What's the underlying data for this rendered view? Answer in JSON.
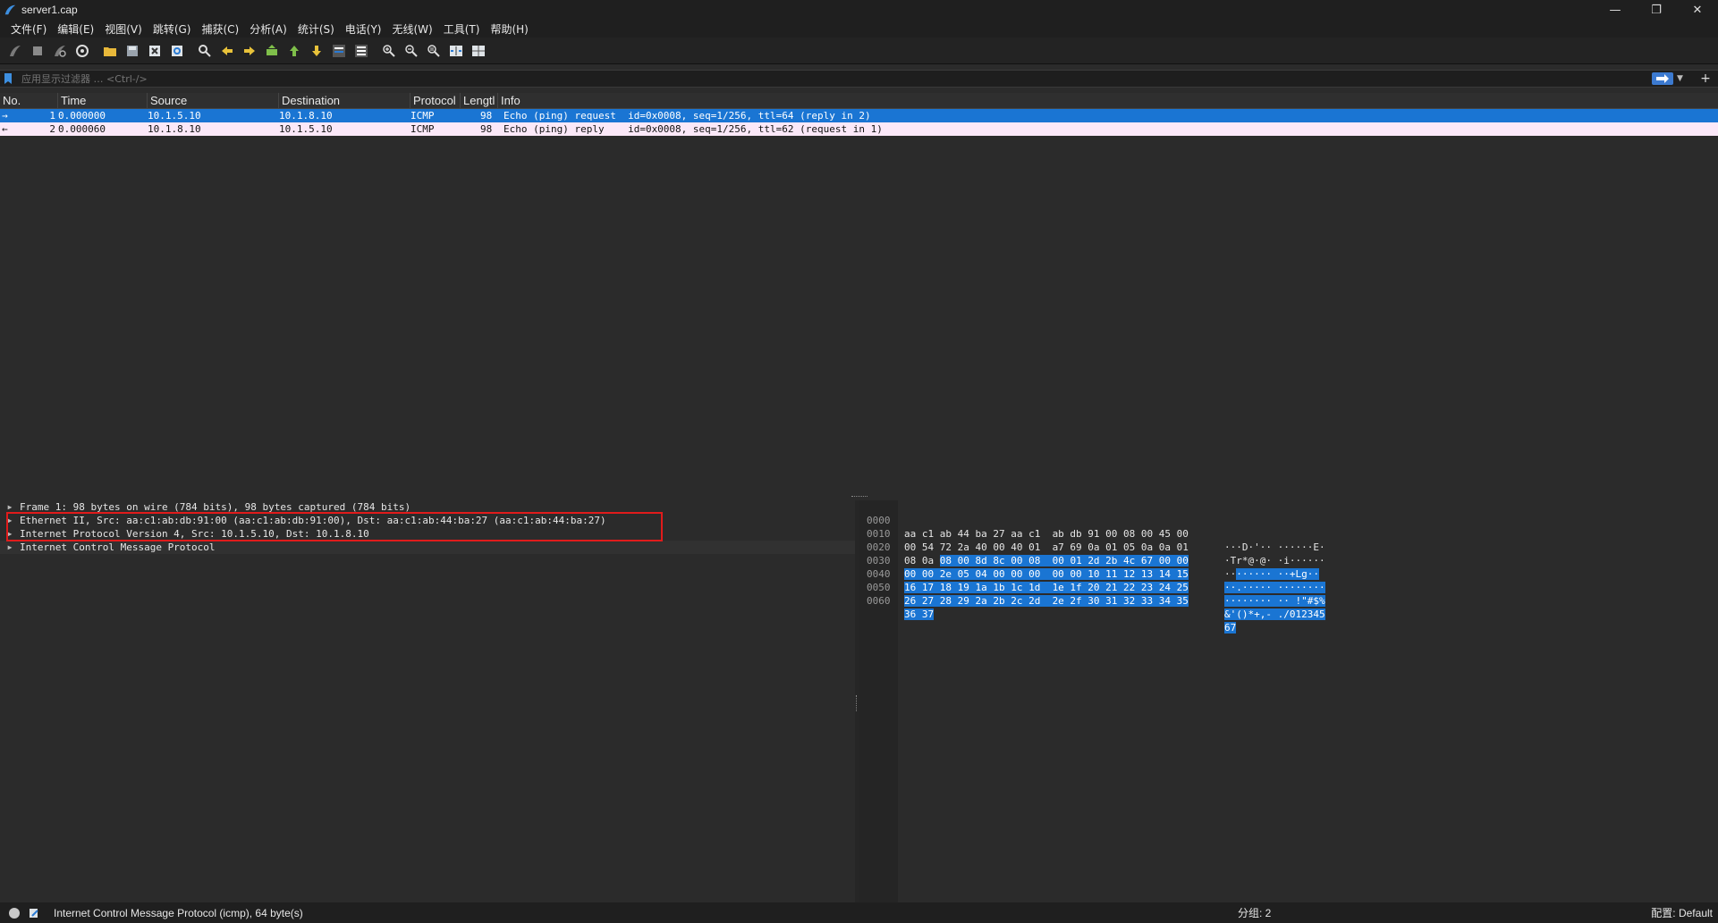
{
  "window": {
    "title": "server1.cap"
  },
  "menu": [
    "文件(F)",
    "编辑(E)",
    "视图(V)",
    "跳转(G)",
    "捕获(C)",
    "分析(A)",
    "统计(S)",
    "电话(Y)",
    "无线(W)",
    "工具(T)",
    "帮助(H)"
  ],
  "filter": {
    "placeholder": "应用显示过滤器 … <Ctrl-/>"
  },
  "packet_list": {
    "columns": [
      "No.",
      "Time",
      "Source",
      "Destination",
      "Protocol",
      "Lengtl",
      "Info"
    ],
    "rows": [
      {
        "no": "1",
        "time": "0.000000",
        "src": "10.1.5.10",
        "dst": "10.1.8.10",
        "proto": "ICMP",
        "len": "98",
        "info": "Echo (ping) request  id=0x0008, seq=1/256, ttl=64 (reply in 2)",
        "direction": "→"
      },
      {
        "no": "2",
        "time": "0.000060",
        "src": "10.1.8.10",
        "dst": "10.1.5.10",
        "proto": "ICMP",
        "len": "98",
        "info": "Echo (ping) reply    id=0x0008, seq=1/256, ttl=62 (request in 1)",
        "direction": "←"
      }
    ]
  },
  "details": [
    "Frame 1: 98 bytes on wire (784 bits), 98 bytes captured (784 bits)",
    "Ethernet II, Src: aa:c1:ab:db:91:00 (aa:c1:ab:db:91:00), Dst: aa:c1:ab:44:ba:27 (aa:c1:ab:44:ba:27)",
    "Internet Protocol Version 4, Src: 10.1.5.10, Dst: 10.1.8.10",
    "Internet Control Message Protocol"
  ],
  "bytes": [
    {
      "offset": "0000",
      "hex_plain": "aa c1 ab 44 ba 27 aa c1  ab db 91 00 08 00 45 00",
      "hex_hl": "",
      "ascii_plain": "···D·'·· ······E·",
      "ascii_hl": ""
    },
    {
      "offset": "0010",
      "hex_plain": "00 54 72 2a 40 00 40 01  a7 69 0a 01 05 0a 0a 01",
      "hex_hl": "",
      "ascii_plain": "·Tr*@·@· ·i······",
      "ascii_hl": ""
    },
    {
      "offset": "0020",
      "hex_plain": "08 0a ",
      "hex_hl": "08 00 8d 8c 00 08  00 01 2d 2b 4c 67 00 00",
      "ascii_plain": "··",
      "ascii_hl": "······ ··+Lg··"
    },
    {
      "offset": "0030",
      "hex_plain": "",
      "hex_hl": "00 00 2e 05 04 00 00 00  00 00 10 11 12 13 14 15",
      "ascii_plain": "",
      "ascii_hl": "··.····· ········"
    },
    {
      "offset": "0040",
      "hex_plain": "",
      "hex_hl": "16 17 18 19 1a 1b 1c 1d  1e 1f 20 21 22 23 24 25",
      "ascii_plain": "",
      "ascii_hl": "········ ·· !\"#$%"
    },
    {
      "offset": "0050",
      "hex_plain": "",
      "hex_hl": "26 27 28 29 2a 2b 2c 2d  2e 2f 30 31 32 33 34 35",
      "ascii_plain": "",
      "ascii_hl": "&'()*+,- ./012345"
    },
    {
      "offset": "0060",
      "hex_plain": "",
      "hex_hl": "36 37",
      "ascii_plain": "",
      "ascii_hl": "67"
    }
  ],
  "status": {
    "message": "Internet Control Message Protocol (icmp), 64 byte(s)",
    "packets": "分组: 2",
    "profile": "配置: Default"
  },
  "colors": {
    "selected_row": "#1a75d3",
    "icmp_row": "#fbe8f8",
    "highlight_box": "#e01b1b"
  }
}
